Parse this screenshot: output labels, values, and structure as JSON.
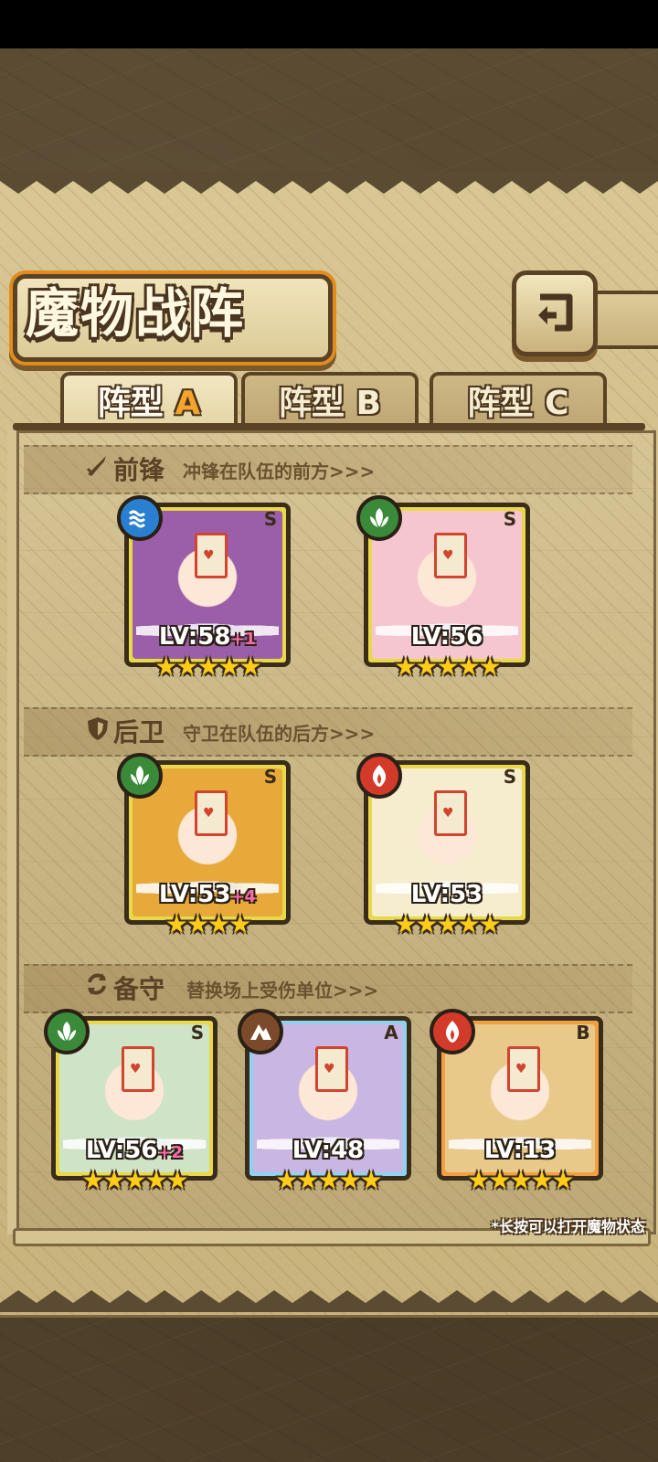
{
  "header": {
    "title": "魔物战阵",
    "back_button_icon": "return-arrow-icon"
  },
  "tabs": [
    {
      "label_prefix": "阵型",
      "label_letter": "A",
      "active": true
    },
    {
      "label_prefix": "阵型",
      "label_letter": "B",
      "active": false
    },
    {
      "label_prefix": "阵型",
      "label_letter": "C",
      "active": false
    }
  ],
  "sections": {
    "front": {
      "title": "前锋",
      "subtitle": "冲锋在队伍的前方>>>",
      "icon": "sword-icon"
    },
    "back": {
      "title": "后卫",
      "subtitle": "守卫在队伍的后方>>>",
      "icon": "shield-icon"
    },
    "reserve": {
      "title": "备守",
      "subtitle": "替换场上受伤单位>>>",
      "icon": "swap-icon"
    }
  },
  "units": [
    {
      "slot": "front-1",
      "element": "water",
      "rank": "S",
      "level": "LV:58",
      "bonus": "+1",
      "stars": 5,
      "frame_color": "#e8d84a",
      "bg": "#9b5ea8"
    },
    {
      "slot": "front-2",
      "element": "wind",
      "rank": "S",
      "level": "LV:56",
      "bonus": "",
      "stars": 5,
      "frame_color": "#e8d84a",
      "bg": "#f6c6d0"
    },
    {
      "slot": "back-1",
      "element": "wind",
      "rank": "S",
      "level": "LV:53",
      "bonus": "+4",
      "stars": 4,
      "frame_color": "#e8d84a",
      "bg": "#e6a93a"
    },
    {
      "slot": "back-2",
      "element": "fire",
      "rank": "S",
      "level": "LV:53",
      "bonus": "",
      "stars": 5,
      "frame_color": "#e8d84a",
      "bg": "#f6edcf"
    },
    {
      "slot": "reserve-1",
      "element": "wind",
      "rank": "S",
      "level": "LV:56",
      "bonus": "+2",
      "stars": 5,
      "frame_color": "#e8d84a",
      "bg": "#cfe3c6"
    },
    {
      "slot": "reserve-2",
      "element": "earth",
      "rank": "A",
      "level": "LV:48",
      "bonus": "",
      "stars": 5,
      "frame_color": "#8fd3f0",
      "bg": "#c9b6e3"
    },
    {
      "slot": "reserve-3",
      "element": "fire",
      "rank": "B",
      "level": "LV:13",
      "bonus": "",
      "stars": 5,
      "frame_color": "#f0a042",
      "bg": "#e9c98a"
    }
  ],
  "stars_text": {
    "five": "★★★★★",
    "four": "★★★★"
  },
  "footer_hint": "*长按可以打开魔物状态",
  "colors": {
    "water": "#2a7fd0",
    "wind": "#3a8a3a",
    "fire": "#d23a2a",
    "earth": "#7a4a2a",
    "gold_star": "#ffcc1a"
  }
}
